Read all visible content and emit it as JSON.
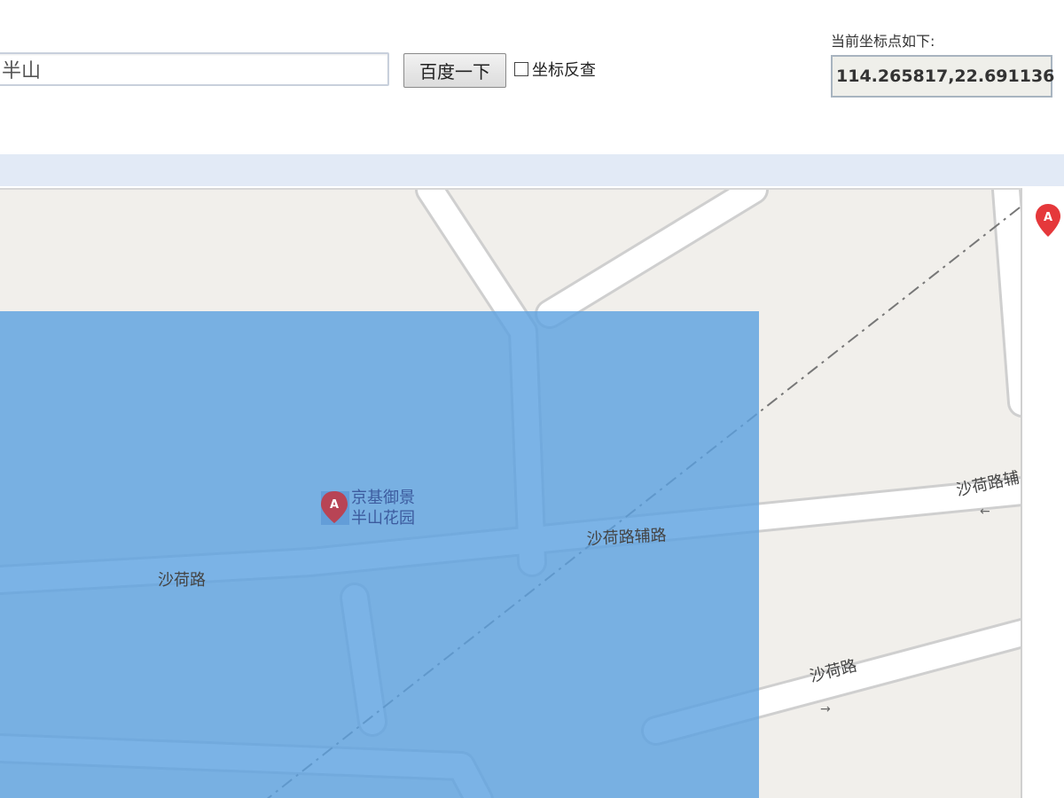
{
  "search": {
    "value": "半山",
    "button_label": "百度一下",
    "reverse_label": "坐标反查",
    "reverse_checked": false
  },
  "coords": {
    "label": "当前坐标点如下:",
    "value": "114.265817,22.691136"
  },
  "map": {
    "roads": {
      "shahe_left": "沙荷路",
      "shahe_right": "沙荷路",
      "shahe_aux": "沙荷路辅路",
      "shahe_aux_edge": "沙荷路辅"
    },
    "poi": {
      "line1": "京基御景",
      "line2": "半山花园",
      "marker_letter": "A"
    },
    "side_marker_letter": "A",
    "selection_color": "#78b0e3",
    "marker_color": "#e5383b"
  }
}
